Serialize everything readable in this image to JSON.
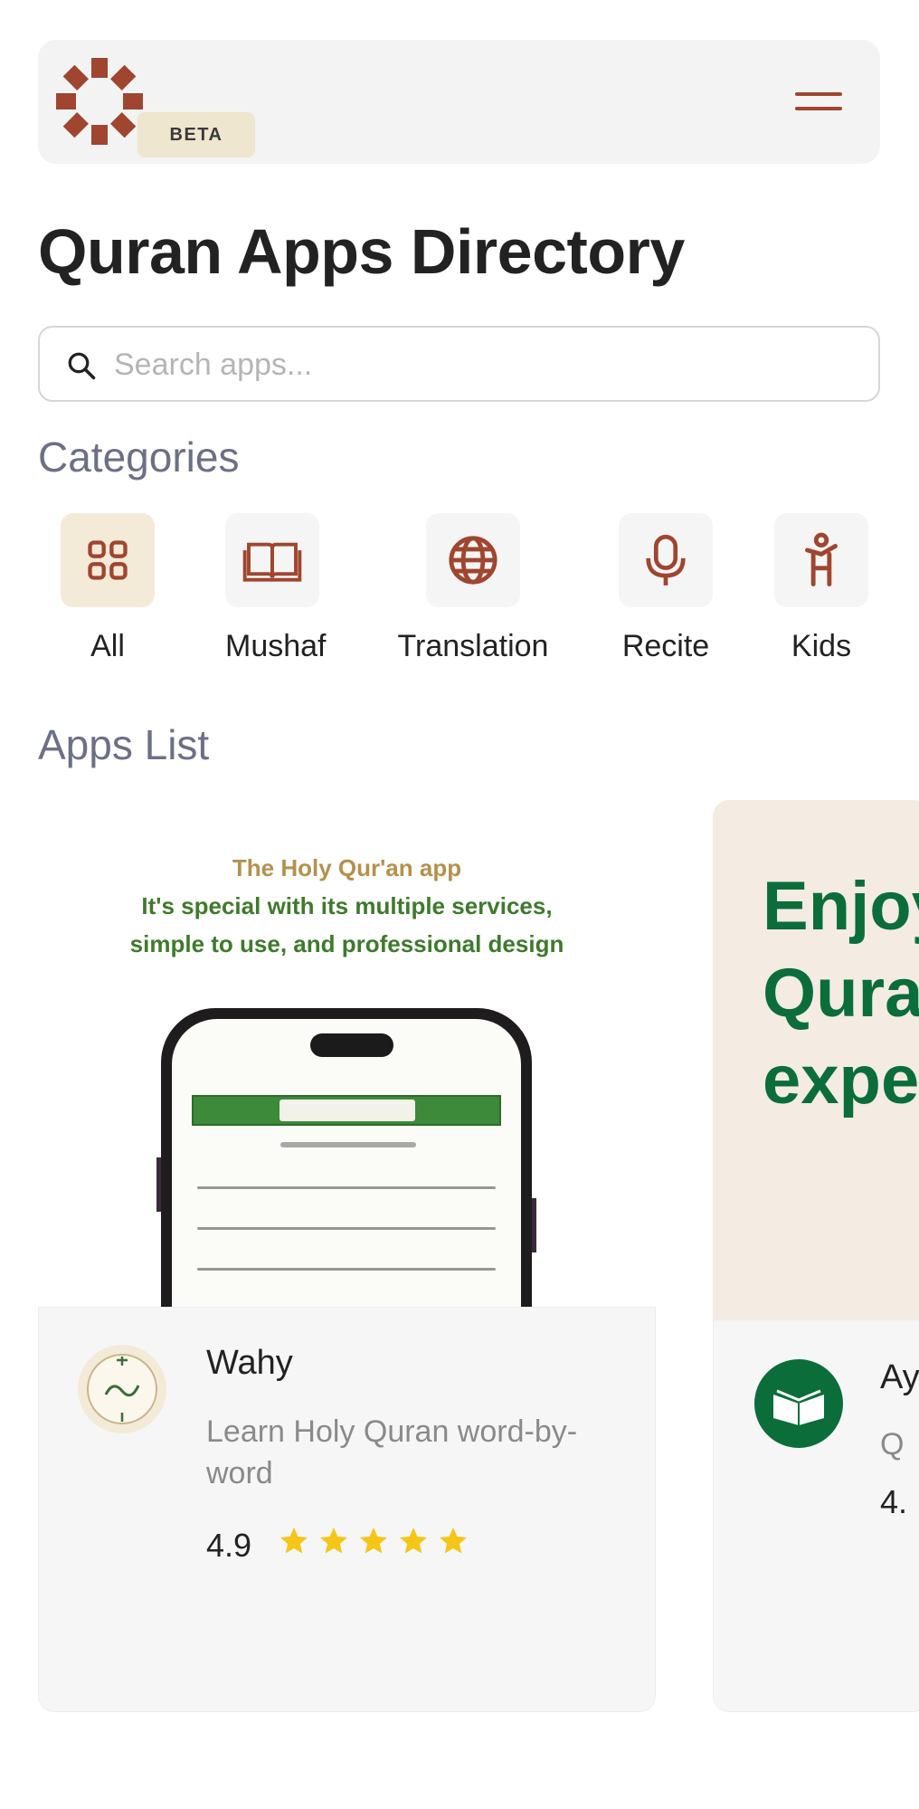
{
  "header": {
    "beta_label": "BETA",
    "logo_icon": "star-logo-icon",
    "menu_icon": "hamburger-menu-icon"
  },
  "page": {
    "title": "Quran Apps Directory"
  },
  "search": {
    "placeholder": "Search apps...",
    "value": ""
  },
  "categories": {
    "heading": "Categories",
    "items": [
      {
        "label": "All",
        "icon": "grid-icon",
        "active": true
      },
      {
        "label": "Mushaf",
        "icon": "book-icon",
        "active": false
      },
      {
        "label": "Translation",
        "icon": "globe-icon",
        "active": false
      },
      {
        "label": "Recite",
        "icon": "microphone-icon",
        "active": false
      },
      {
        "label": "Kids",
        "icon": "child-icon",
        "active": false
      }
    ]
  },
  "apps": {
    "heading": "Apps List",
    "items": [
      {
        "name": "Wahy",
        "description": "Learn Holy Quran word-by-word",
        "rating": "4.9",
        "stars": 5,
        "promo_title": "The Holy Qur'an app",
        "promo_lines": [
          "It's special with its multiple services,",
          "simple to use, and professional design"
        ]
      },
      {
        "name": "Ay",
        "description": "Q",
        "rating": "4.",
        "promo_lines": [
          "Enjoy",
          "Qura",
          "expe"
        ]
      }
    ]
  },
  "colors": {
    "accent": "#a0452f",
    "section_heading": "#6c7086",
    "active_tile": "#f4ead8",
    "star": "#f5c518",
    "promo_green": "#0b6e3a"
  }
}
